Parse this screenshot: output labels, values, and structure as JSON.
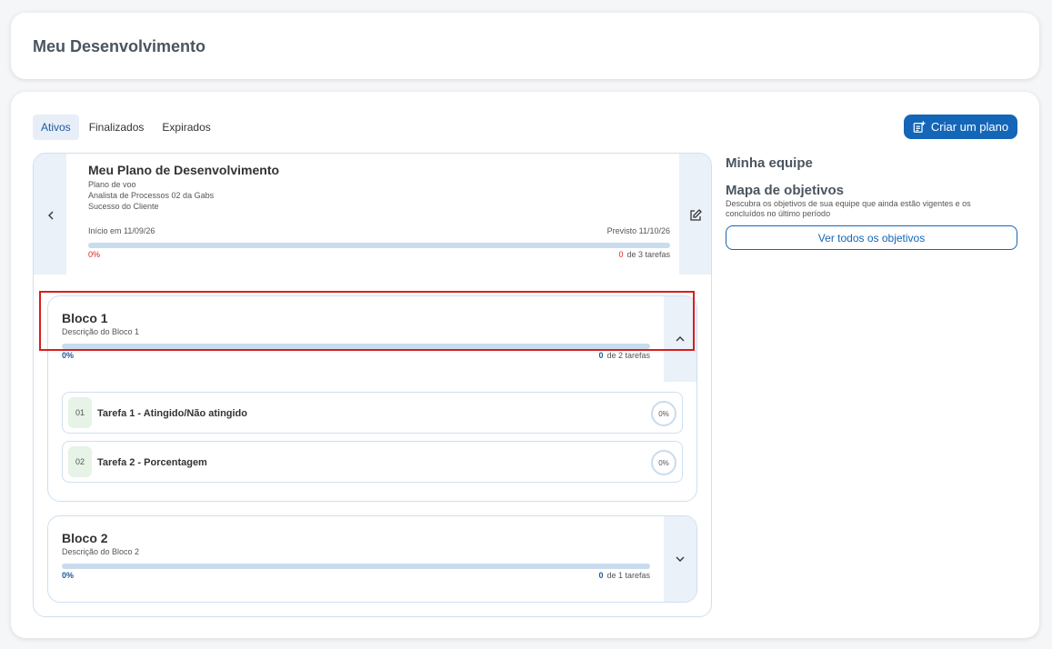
{
  "header": {
    "title": "Meu Desenvolvimento"
  },
  "tabs": [
    {
      "label": "Ativos",
      "active": true
    },
    {
      "label": "Finalizados",
      "active": false
    },
    {
      "label": "Expirados",
      "active": false
    }
  ],
  "create_plan_button": {
    "label": "Criar um plano",
    "icon": "add-note-icon"
  },
  "plan": {
    "title": "Meu Plano de Desenvolvimento",
    "type": "Plano de voo",
    "role": "Analista de Processos 02 da Gabs",
    "area": "Sucesso do Cliente",
    "start": "Início em 11/09/26",
    "forecast": "Previsto 11/10/26",
    "progress_pct": "0%",
    "progress_value": 0,
    "tasks_done": "0",
    "tasks_total": "de 3 tarefas"
  },
  "blocks": [
    {
      "title": "Bloco 1",
      "description": "Descrição do Bloco 1",
      "progress_pct": "0%",
      "tasks_done": "0",
      "tasks_total": "de 2 tarefas",
      "expanded": true,
      "tasks": [
        {
          "number": "01",
          "label": "Tarefa 1 - Atingido/Não atingido",
          "progress": "0%"
        },
        {
          "number": "02",
          "label": "Tarefa 2 - Porcentagem",
          "progress": "0%"
        }
      ]
    },
    {
      "title": "Bloco 2",
      "description": "Descrição do Bloco 2",
      "progress_pct": "0%",
      "tasks_done": "0",
      "tasks_total": "de 1 tarefas",
      "expanded": false
    }
  ],
  "right_panel": {
    "team_title": "Minha equipe",
    "objectives_title": "Mapa de objetivos",
    "objectives_desc": "Descubra os objetivos de sua equipe que ainda estão vigentes e os concluídos no último período",
    "see_all_label": "Ver todos os objetivos"
  },
  "colors": {
    "primary": "#1466b8",
    "highlight": "#d81e1e",
    "danger": "#e02020"
  }
}
